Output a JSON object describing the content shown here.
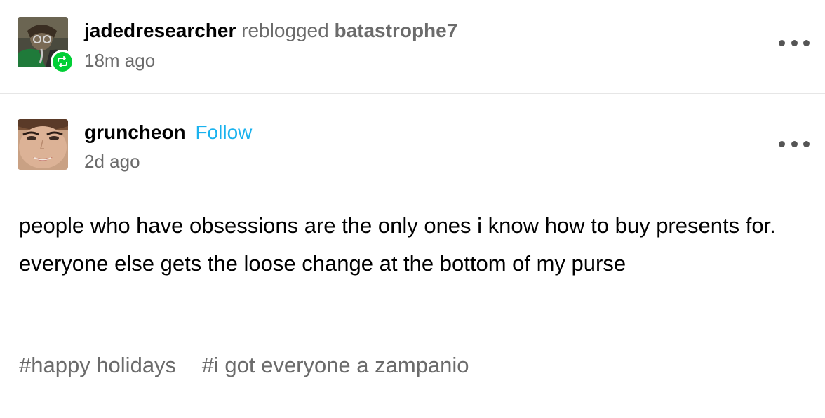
{
  "reblog_header": {
    "reblogger": "jadedresearcher",
    "action": "reblogged",
    "source": "batastrophe7",
    "timestamp": "18m ago",
    "avatar_icon": "reblogger-avatar-icon",
    "badge_icon": "reblog-icon",
    "badge_color": "#00cf35"
  },
  "post": {
    "author": "gruncheon",
    "follow_label": "Follow",
    "follow_color": "#1ab2ee",
    "timestamp": "2d ago",
    "avatar_icon": "author-avatar-icon",
    "body": "people who have obsessions are the only ones i know how to buy presents for. everyone else gets the loose change at the bottom of my purse",
    "tags": [
      "#happy holidays",
      "#i got everyone a zampanio"
    ]
  },
  "menu_icon": "more-options-icon"
}
